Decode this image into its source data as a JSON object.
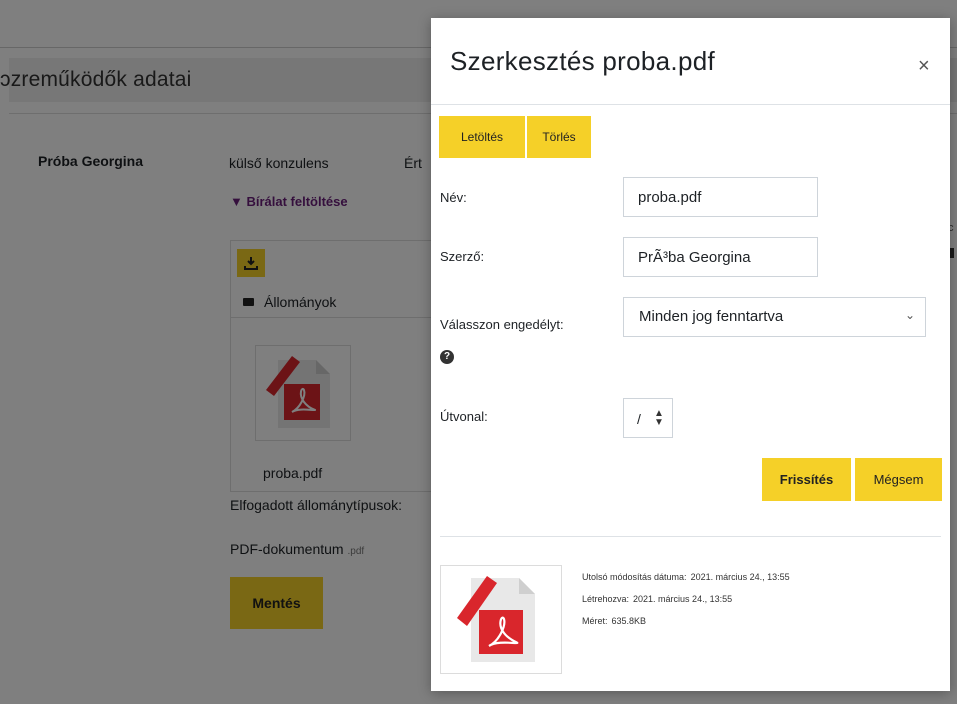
{
  "background": {
    "section_title": "ɔzreműködők adatai",
    "person_name": "Próba Georgina",
    "person_role": "külső konzulens",
    "cut_off_text": "Ért",
    "toggle_label": "▼ Bírálat feltöltése",
    "folder_label": "Állományok",
    "file_name": "proba.pdf",
    "accepted_types_label": "Elfogadott állománytípusok:",
    "pdf_doc_label": "PDF-dokumentum",
    "pdf_ext": ".pdf",
    "save_button": "Mentés",
    "right_edge_char": "c"
  },
  "modal": {
    "title": "Szerkesztés proba.pdf",
    "close_glyph": "×",
    "download_button": "Letöltés",
    "delete_button": "Törlés",
    "name_label": "Név:",
    "name_value": "proba.pdf",
    "author_label": "Szerző:",
    "author_value": "PrÃ³ba Georgina",
    "license_label": "Válasszon engedélyt:",
    "license_value": "Minden jog fenntartva",
    "help_glyph": "?",
    "path_label": "Útvonal:",
    "path_value": "/",
    "update_button": "Frissítés",
    "cancel_button": "Mégsem",
    "meta": {
      "modified_label": "Utolsó módosítás dátuma:",
      "modified_value": "2021. március 24., 13:55",
      "created_label": "Létrehozva:",
      "created_value": "2021. március 24., 13:55",
      "size_label": "Méret:",
      "size_value": "635.8KB"
    }
  },
  "colors": {
    "accent_yellow": "#f5d028",
    "toggle_purple": "#6a1f7a",
    "pdf_red": "#d9262c"
  }
}
